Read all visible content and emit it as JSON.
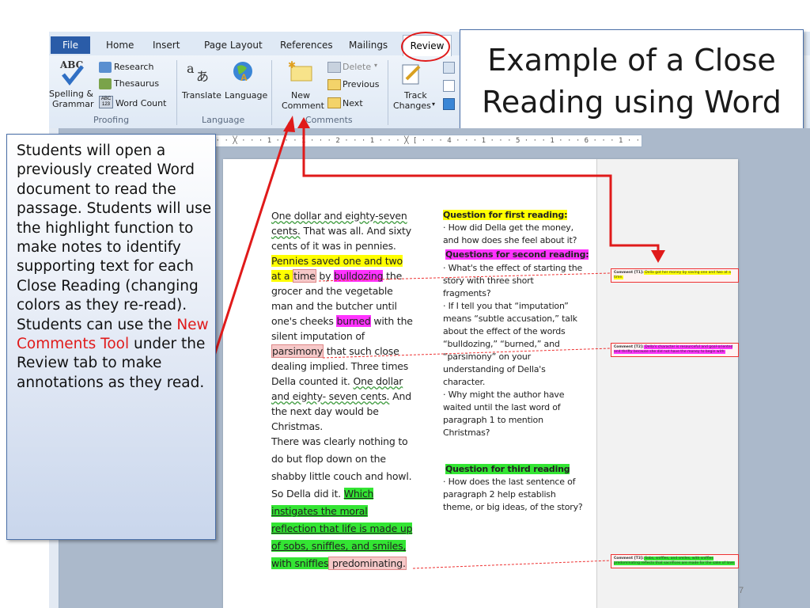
{
  "ribbon": {
    "tabs": [
      "File",
      "Home",
      "Insert",
      "Page Layout",
      "References",
      "Mailings",
      "Review"
    ],
    "proofing": {
      "spelling": [
        "Spelling &",
        "Grammar"
      ],
      "research": "Research",
      "thesaurus": "Thesaurus",
      "word_count": "Word Count",
      "group": "Proofing"
    },
    "language": {
      "translate": "Translate",
      "language": "Language",
      "group": "Language"
    },
    "comments": {
      "new_comment": [
        "New",
        "Comment"
      ],
      "delete": "Delete",
      "previous": "Previous",
      "next": "Next",
      "group": "Comments"
    },
    "tracking": {
      "track_changes": [
        "Track",
        "Changes"
      ]
    }
  },
  "title": {
    "line1": "Example of a Close",
    "line2": "Reading using Word"
  },
  "ruler": "1 · · · ╳ · · · 1 · · · 1 · · · 2 · · · 1 · · · ╳  [  · · · 4 · · · 1 · · · 5 · · · 1 · · · 6 · · · 1 · · · 7 · · ·",
  "passage": {
    "l1": "One dollar and eighty-seven",
    "l2a": "cents.",
    "l2b": " That was all. And sixty",
    "l3": "cents of it was in pennies.",
    "l4": "Pennies saved one and two",
    "l5a": "at a ",
    "l5b": "time",
    "l5c": " by ",
    "l5d": "bulldozing",
    "l5e": " the",
    "l6": "grocer and the vegetable",
    "l7": "man and the butcher until",
    "l8a": "one's cheeks ",
    "l8b": "burned",
    "l8c": " with the",
    "l9": "silent imputation of",
    "l10a": "parsimony",
    "l10b": " that such close",
    "l11": "dealing implied. Three times",
    "l12a": "Della counted it. ",
    "l12b": "One dollar",
    "l13a": "and eighty- seven cents.",
    "l13b": " And",
    "l14": "the next day would be",
    "l15": "Christmas.",
    "l16": " There was clearly nothing to",
    "l17": "do but flop down on the",
    "l18": "shabby little couch and howl.",
    "l19a": "So Della did it. ",
    "l19b": "Which",
    "l20": "instigates the moral",
    "l21": "reflection that life is made up",
    "l22": "of sobs, sniffles, and smiles,",
    "l23a": "with sniffles",
    "l23b": " predominating."
  },
  "questions": {
    "q1h": "Question for first reading:",
    "q1a": "· How did Della get the money,",
    "q1b": "and how does she feel about it?",
    "q2h": "Questions for second reading:",
    "q2a": "· What's the effect of starting the",
    "q2b": "story with three short",
    "q2c": "fragments?",
    "q2d": "· If I tell you that “imputation”",
    "q2e": "means “subtle accusation,” talk",
    "q2f": "about the effect of the words",
    "q2g": "“bulldozing,” “burned,” and",
    "q2h2": "“parsimony” on your",
    "q2i": "understanding of Della's",
    "q2j": "character.",
    "q2k": "· Why might the author have",
    "q2l": "waited until the last word of",
    "q2m": "paragraph 1 to mention",
    "q2n": "Christmas?",
    "q3h": "Question for third reading",
    "q3a": "· How does the last sentence of",
    "q3b": "paragraph 2 help establish",
    "q3c": "theme, or big ideas, of the story?"
  },
  "comments": {
    "c1_tag": "Comment [T1]:",
    "c1": " Della got her money by saving one and two at a time.",
    "c2_tag": "Comment [T2]:",
    "c2": " Della's character is resourceful and goal-oriented and thrifty because she did not have the money to begin with.",
    "c3_tag": "Comment [T3]:",
    "c3": " Sobs, sniffles, and smiles, with sniffles predominating reflects that sacrifices are made for the sake of love."
  },
  "callout": {
    "text1": "Students will open a previously created Word document to read the passage. Students will use the highlight function to make notes to identify supporting text for each Close Reading (changing colors as they re-read). Students can use the ",
    "highlight": "New Comments Tool",
    "text2": " under the Review tab to make annotations as they read."
  },
  "page_number": "7",
  "colors": {
    "accent_red": "#e01a1a",
    "highlight_yellow": "#ffff00",
    "highlight_magenta": "#ff33ff",
    "highlight_green": "#33e533",
    "highlight_pink": "#f6c9c9"
  }
}
